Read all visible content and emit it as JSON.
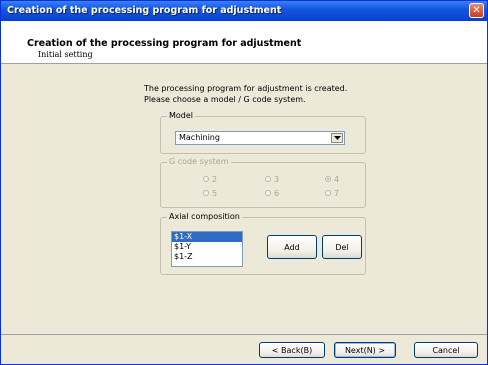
{
  "window": {
    "title": "Creation of the processing program for adjustment",
    "close_glyph": "✕"
  },
  "header": {
    "title": "Creation of the processing program for adjustment",
    "subtitle": "Initial setting"
  },
  "intro": {
    "line1": "The processing program for adjustment is created.",
    "line2": "Please choose a model / G code system."
  },
  "model": {
    "label": "Model",
    "selected": "Machining",
    "arrow_glyph": "▼"
  },
  "gcode": {
    "label": "G code system",
    "options": [
      "2",
      "3",
      "4",
      "5",
      "6",
      "7"
    ],
    "selected": "4",
    "enabled": false
  },
  "axial": {
    "label": "Axial composition",
    "items": [
      "$1-X",
      "$1-Y",
      "$1-Z"
    ],
    "selected_index": 0,
    "add_label": "Add",
    "del_label": "Del"
  },
  "footer": {
    "back_label": "< Back(B)",
    "next_label": "Next(N) >",
    "cancel_label": "Cancel"
  },
  "colors": {
    "titlebar": "#0a3fd0",
    "face": "#ece9d8",
    "selection": "#316ac5"
  },
  "icons": {
    "close": "close-icon",
    "dropdown": "chevron-down-icon"
  }
}
